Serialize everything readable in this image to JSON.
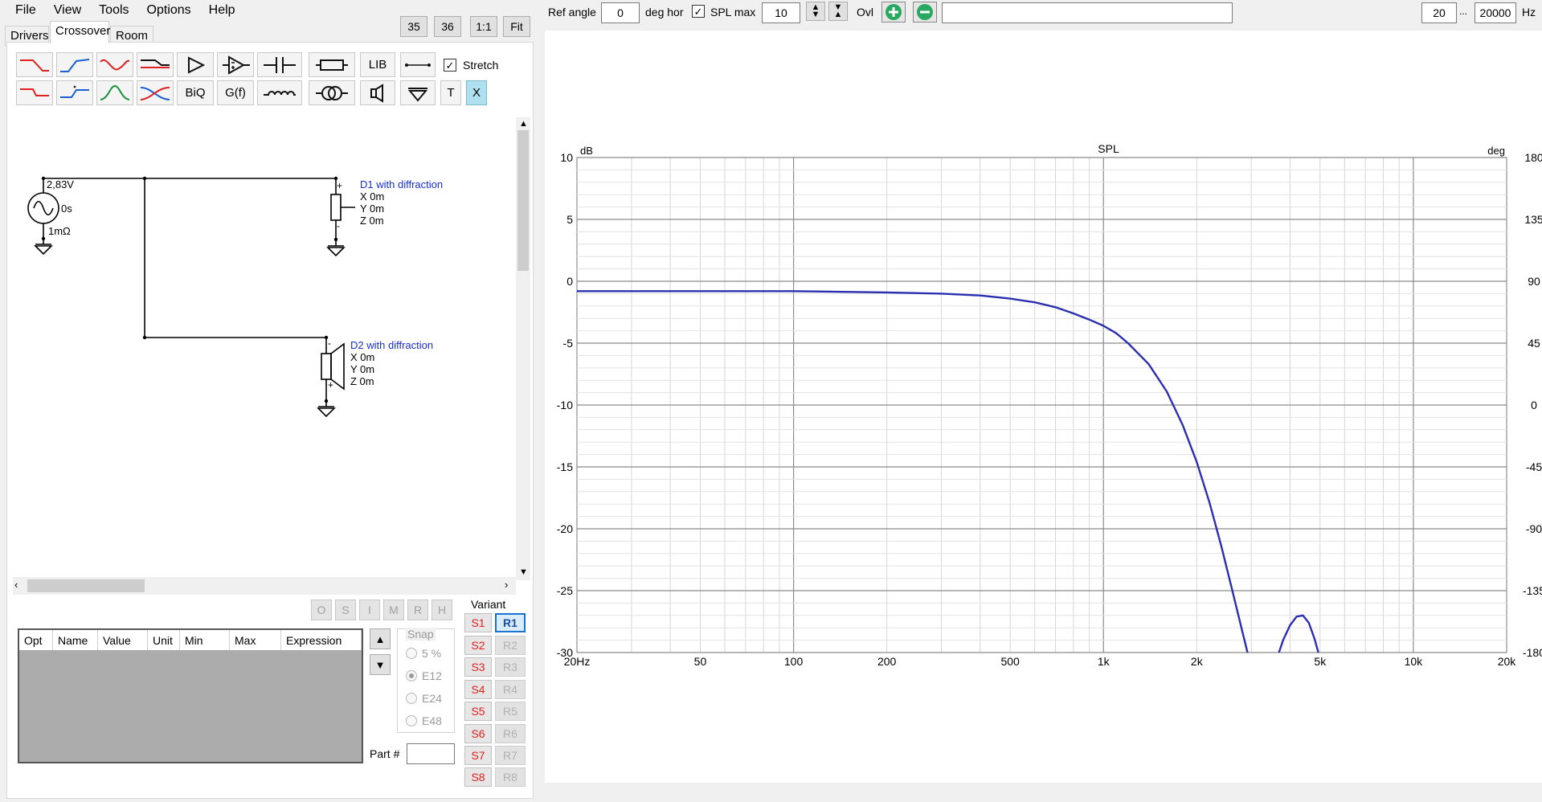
{
  "menu": [
    "File",
    "View",
    "Tools",
    "Options",
    "Help"
  ],
  "zoom_buttons": [
    "35",
    "36",
    "1:1",
    "Fit"
  ],
  "tabs": [
    "Drivers",
    "Crossover",
    "Room"
  ],
  "toolbar": {
    "lib_label": "LIB",
    "biq_label": "BiQ",
    "gf_label": "G(f)",
    "t_label": "T",
    "x_label": "X",
    "stretch_label": "Stretch",
    "stretch_checked": true
  },
  "schematic": {
    "source_voltage": "2,83V",
    "source_delay": "0s",
    "source_impedance": "1mΩ",
    "plus": "+",
    "minus": "-",
    "d1": {
      "name": "D1 with diffraction",
      "x": "X 0m",
      "y": "Y 0m",
      "z": "Z 0m"
    },
    "d2": {
      "name": "D2 with diffraction",
      "x": "X 0m",
      "y": "Y 0m",
      "z": "Z 0m"
    }
  },
  "opt_buttons": [
    "O",
    "S",
    "I",
    "M",
    "R",
    "H"
  ],
  "table": {
    "columns": [
      "Opt",
      "Name",
      "Value",
      "Unit",
      "Min",
      "Max",
      "Expression"
    ]
  },
  "snap": {
    "title": "Snap",
    "options": [
      "5 %",
      "E12",
      "E24",
      "E48"
    ],
    "selected": "E12"
  },
  "part_label": "Part #",
  "part_value": "",
  "variant": {
    "title": "Variant",
    "s": [
      "S1",
      "S2",
      "S3",
      "S4",
      "S5",
      "S6",
      "S7",
      "S8"
    ],
    "r": [
      "R1",
      "R2",
      "R3",
      "R4",
      "R5",
      "R6",
      "R7",
      "R8"
    ],
    "active_r": "R1"
  },
  "top_controls": {
    "ref_angle_label": "Ref angle",
    "ref_angle_value": "0",
    "deg_hor_label": "deg hor",
    "spl_max_checked": true,
    "spl_max_label": "SPL max",
    "spl_max_value": "10",
    "ovl_label": "Ovl",
    "overlay_text": "",
    "freq_min": "20",
    "freq_sep": "...",
    "freq_max": "20000",
    "hz_label": "Hz"
  },
  "colors": {
    "curve": "#2a2fb0",
    "red": "#e02020",
    "blue": "#1a5fd8",
    "green": "#1a8f3a",
    "label_blue": "#1a2fd0"
  },
  "chart_data": {
    "type": "line",
    "title": "SPL",
    "y_unit_left": "dB",
    "y_unit_right": "deg",
    "xscale": "log",
    "xlim": [
      20,
      20000
    ],
    "ylim": [
      -30,
      10
    ],
    "y2lim": [
      -180,
      180
    ],
    "x_ticks": [
      {
        "v": 20,
        "l": "20Hz"
      },
      {
        "v": 50,
        "l": "50"
      },
      {
        "v": 100,
        "l": "100"
      },
      {
        "v": 200,
        "l": "200"
      },
      {
        "v": 500,
        "l": "500"
      },
      {
        "v": 1000,
        "l": "1k"
      },
      {
        "v": 2000,
        "l": "2k"
      },
      {
        "v": 5000,
        "l": "5k"
      },
      {
        "v": 10000,
        "l": "10k"
      },
      {
        "v": 20000,
        "l": "20k"
      }
    ],
    "y_ticks": [
      10,
      5,
      0,
      -5,
      -10,
      -15,
      -20,
      -25,
      -30
    ],
    "y2_ticks": [
      180,
      135,
      90,
      45,
      0,
      -45,
      -90,
      -135,
      -180
    ],
    "series": [
      {
        "color": "#2a2fb0",
        "x": [
          20,
          50,
          100,
          200,
          300,
          400,
          500,
          600,
          700,
          800,
          900,
          1000,
          1100,
          1200,
          1400,
          1600,
          1800,
          2000,
          2200,
          2400,
          2600,
          2800,
          2950
        ],
        "y": [
          -0.8,
          -0.8,
          -0.8,
          -0.9,
          -1.0,
          -1.15,
          -1.4,
          -1.7,
          -2.1,
          -2.6,
          -3.1,
          -3.6,
          -4.2,
          -5.0,
          -6.7,
          -8.9,
          -11.6,
          -14.6,
          -17.9,
          -21.4,
          -24.9,
          -28.2,
          -30.5
        ]
      },
      {
        "color": "#2a2fb0",
        "x": [
          3650,
          3800,
          4000,
          4200,
          4400,
          4600,
          4800,
          5000
        ],
        "y": [
          -30.3,
          -29.0,
          -27.8,
          -27.1,
          -27.0,
          -27.6,
          -28.9,
          -30.5
        ]
      }
    ]
  }
}
